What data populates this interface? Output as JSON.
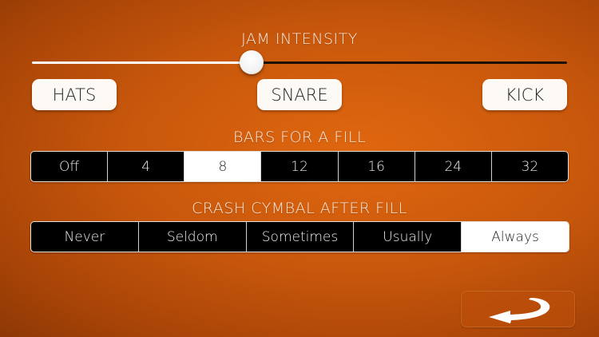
{
  "jam_intensity": {
    "title": "JAM INTENSITY",
    "value_fraction": 0.41
  },
  "instruments": [
    {
      "label": "HATS"
    },
    {
      "label": "SNARE"
    },
    {
      "label": "KICK"
    }
  ],
  "bars_for_fill": {
    "title": "BARS FOR A FILL",
    "options": [
      "Off",
      "4",
      "8",
      "12",
      "16",
      "24",
      "32"
    ],
    "selected": "8"
  },
  "crash_cymbal": {
    "title": "CRASH CYMBAL AFTER FILL",
    "options": [
      "Never",
      "Seldom",
      "Sometimes",
      "Usually",
      "Always"
    ],
    "selected": "Always"
  },
  "back_button": {
    "icon": "curved-back-arrow-icon"
  },
  "colors": {
    "background": "#c9580c",
    "selected_segment": "#ffffff",
    "segment_bg": "#000000",
    "button_bg": "#fdfaf6"
  }
}
